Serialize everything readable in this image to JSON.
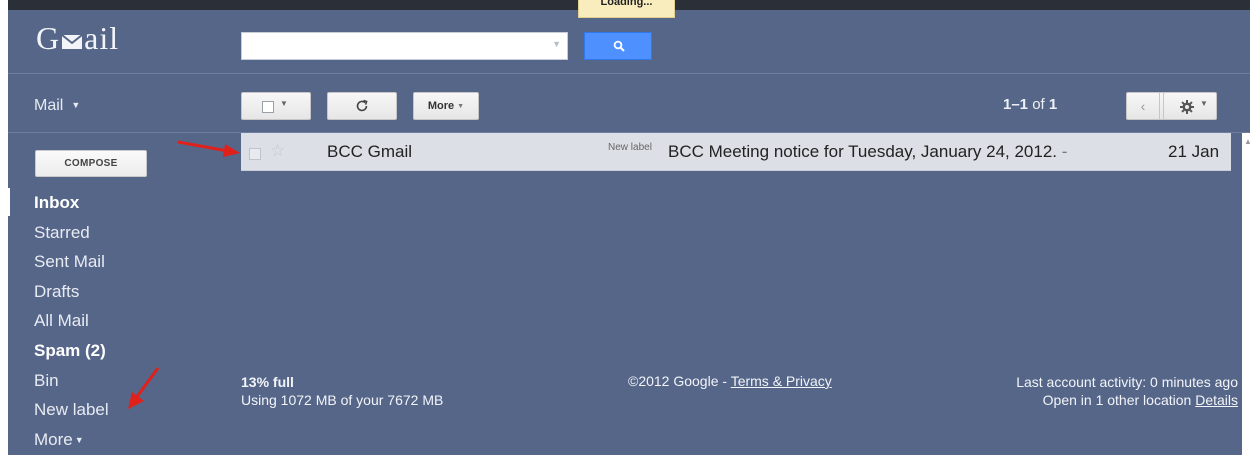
{
  "loading_tab": {
    "label": "Loading..."
  },
  "logo": {
    "pre": "G",
    "post": "ail"
  },
  "search": {
    "value": "",
    "placeholder": ""
  },
  "mail_menu": {
    "label": "Mail"
  },
  "toolbar": {
    "more_label": "More"
  },
  "pagination": {
    "range": "1–1",
    "of_text": "of",
    "total": "1"
  },
  "compose": {
    "label": "COMPOSE"
  },
  "nav": {
    "items": [
      {
        "label": "Inbox"
      },
      {
        "label": "Starred"
      },
      {
        "label": "Sent Mail"
      },
      {
        "label": "Drafts"
      },
      {
        "label": "All Mail"
      },
      {
        "label": "Spam (2)"
      },
      {
        "label": "Bin"
      },
      {
        "label": "New label"
      },
      {
        "label": "More"
      }
    ]
  },
  "messages": [
    {
      "sender": "BCC Gmail",
      "label": "New label",
      "subject": "BCC Meeting notice for Tuesday, January 24, 2012.",
      "snippet": " -",
      "date": "21 Jan"
    }
  ],
  "footer": {
    "storage_percent": "13% full",
    "storage_detail": "Using 1072 MB of your 7672 MB",
    "copyright": "©2012 Google -",
    "terms_link": "Terms & Privacy",
    "activity": "Last account activity: 0 minutes ago",
    "other_location": "Open in 1 other location",
    "details_link": "Details"
  },
  "colors": {
    "background": "#566689",
    "annotation_arrow": "#e0201b",
    "search_button": "#4d90fe",
    "selected_row": "#dcdfe5"
  }
}
